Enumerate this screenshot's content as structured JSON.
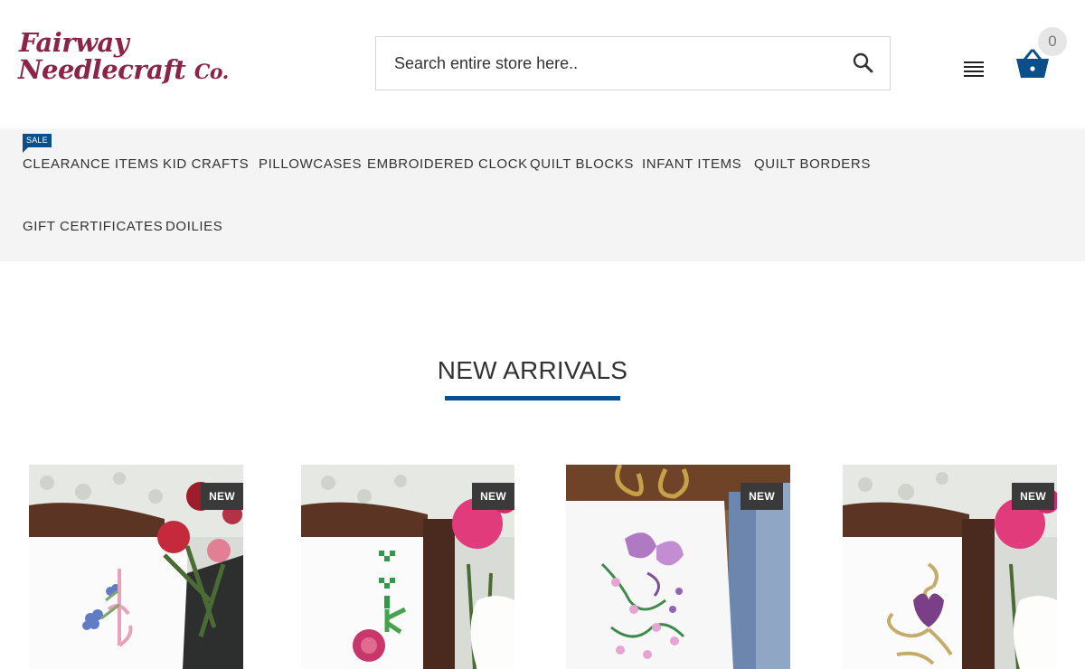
{
  "brand": {
    "line1": "Fairway",
    "line2": "Needlecraft",
    "line2_suffix": "Co."
  },
  "search": {
    "placeholder": "Search entire store here..",
    "value": ""
  },
  "cart": {
    "count": "0"
  },
  "icons": {
    "search": "search-icon",
    "menu": "menu-icon",
    "cart": "basket-icon"
  },
  "colors": {
    "brand": "#8c2447",
    "accent": "#0a4f8a",
    "nav_bg": "#f4f4f4",
    "badge_bg": "#3a3a3a"
  },
  "nav": {
    "sale_label": "SALE",
    "items": [
      {
        "label": "CLEARANCE ITEMS"
      },
      {
        "label": "KID CRAFTS"
      },
      {
        "label": "PILLOWCASES"
      },
      {
        "label": "EMBROIDERED CLOCK"
      },
      {
        "label": "QUILT BLOCKS"
      },
      {
        "label": "INFANT ITEMS"
      },
      {
        "label": "QUILT BORDERS"
      },
      {
        "label": "GIFT CERTIFICATES"
      },
      {
        "label": "DOILIES"
      }
    ]
  },
  "section": {
    "title": "NEW ARRIVALS"
  },
  "products": [
    {
      "badge": "NEW"
    },
    {
      "badge": "NEW"
    },
    {
      "badge": "NEW"
    },
    {
      "badge": "NEW"
    }
  ]
}
